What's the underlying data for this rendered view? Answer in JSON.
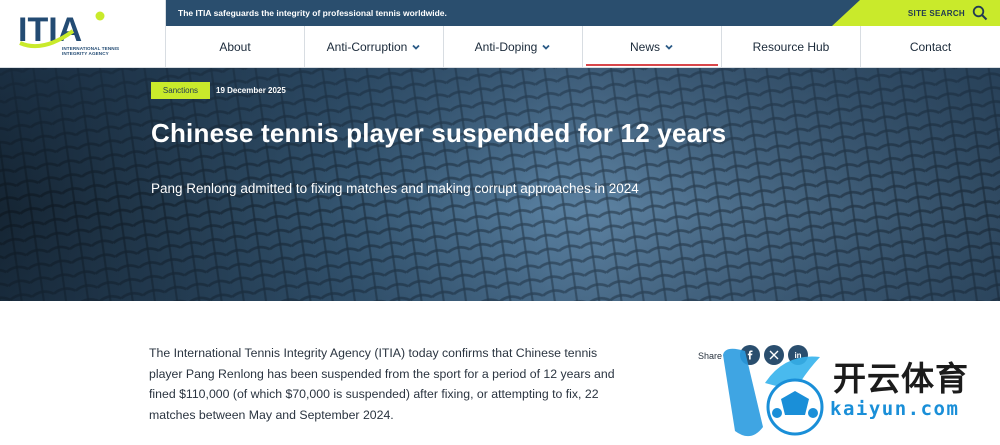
{
  "logo": {
    "mark": "ITIA",
    "subtitle_line1": "INTERNATIONAL TENNIS",
    "subtitle_line2": "INTEGRITY AGENCY"
  },
  "topbar": {
    "tagline": "The ITIA safeguards the integrity of professional tennis worldwide.",
    "search_label": "SITE SEARCH",
    "search_icon": "search-icon",
    "accent": "#c9ea2b",
    "bar_color": "#2a4e6e"
  },
  "nav": {
    "items": [
      {
        "label": "About",
        "dropdown": false
      },
      {
        "label": "Anti-Corruption",
        "dropdown": true
      },
      {
        "label": "Anti-Doping",
        "dropdown": true
      },
      {
        "label": "News",
        "dropdown": true,
        "active": true
      },
      {
        "label": "Resource Hub",
        "dropdown": false
      },
      {
        "label": "Contact",
        "dropdown": false
      }
    ],
    "active_underline_color": "#d9464a"
  },
  "hero": {
    "tag": "Sanctions",
    "date": "19 December 2025",
    "title": "Chinese tennis player suspended for 12 years",
    "subtitle": "Pang Renlong admitted to fixing matches and making corrupt approaches in 2024"
  },
  "article": {
    "paragraph": "The International Tennis Integrity Agency (ITIA) today confirms that Chinese tennis player Pang Renlong has been suspended from the sport for a period of 12 years and fined $110,000 (of which $70,000 is suspended) after fixing, or attempting to fix, 22 matches between May and September 2024."
  },
  "share": {
    "label": "Share",
    "icons": [
      "facebook-icon",
      "twitter-icon",
      "linkedin-icon"
    ],
    "linkedin_text": "in"
  },
  "watermark": {
    "cn": "开云体育",
    "en": "kaiyun.com"
  }
}
